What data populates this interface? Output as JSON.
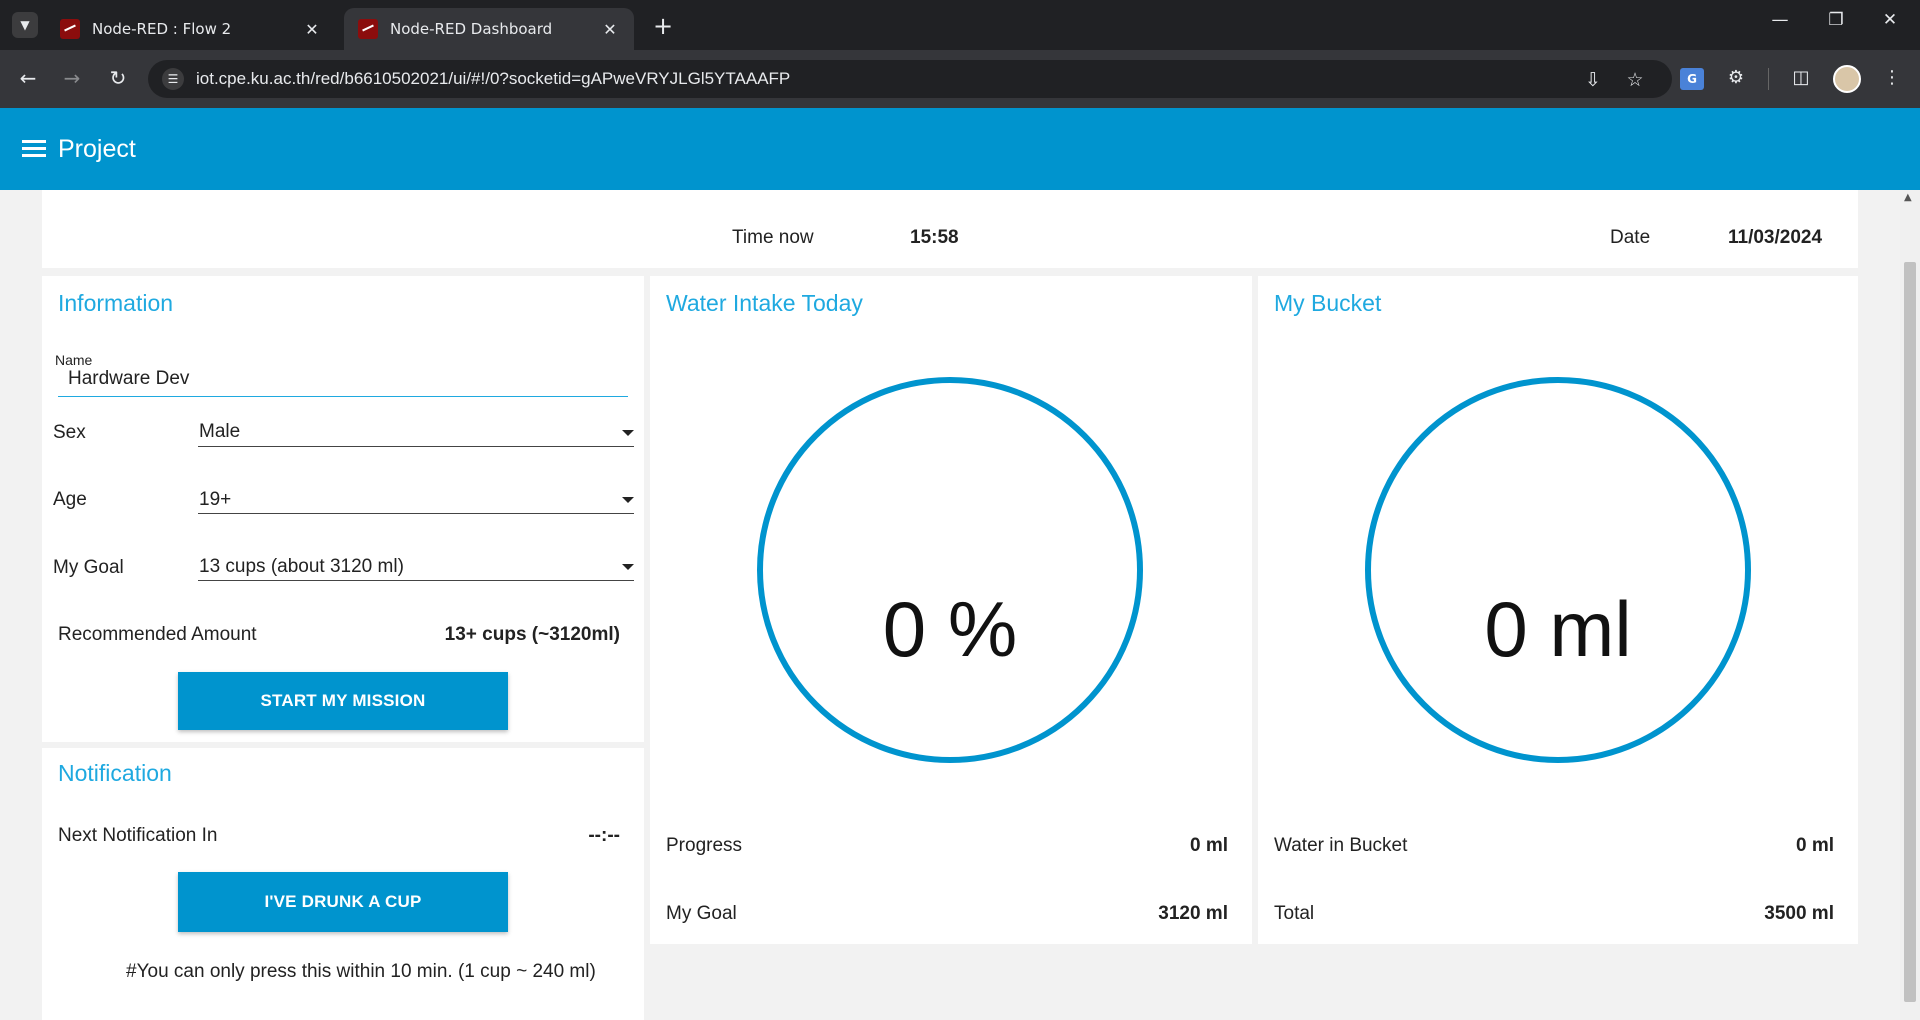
{
  "browser": {
    "tabs": [
      {
        "label": "Node-RED : Flow 2",
        "active": false
      },
      {
        "label": "Node-RED Dashboard",
        "active": true
      }
    ],
    "url": "iot.cpe.ku.ac.th/red/b6610502021/ui/#!/0?socketid=gAPweVRYJLGl5YTAAAFP"
  },
  "header": {
    "title": "Project"
  },
  "timebar": {
    "time_label": "Time now",
    "time_value": "15:58",
    "date_label": "Date",
    "date_value": "11/03/2024"
  },
  "information": {
    "title": "Information",
    "name_label": "Name",
    "name_value": "Hardware Dev",
    "sex_label": "Sex",
    "sex_value": "Male",
    "age_label": "Age",
    "age_value": "19+",
    "goal_label": "My Goal",
    "goal_value": "13 cups (about 3120 ml)",
    "recommended_label": "Recommended Amount",
    "recommended_value": "13+ cups (~3120ml)",
    "start_button": "START MY MISSION"
  },
  "notification": {
    "title": "Notification",
    "next_label": "Next Notification In",
    "next_value": "--:--",
    "drunk_button": "I'VE DRUNK A CUP",
    "note": "#You can only press this within 10 min. (1 cup ~ 240 ml)"
  },
  "water_intake": {
    "title": "Water Intake Today",
    "gauge_value": "0 %",
    "progress_percent": 0,
    "progress_label": "Progress",
    "progress_value": "0 ml",
    "goal_label": "My Goal",
    "goal_value": "3120 ml"
  },
  "bucket": {
    "title": "My Bucket",
    "gauge_value": "0 ml",
    "level_percent": 0,
    "water_label": "Water in Bucket",
    "water_value": "0 ml",
    "total_label": "Total",
    "total_value": "3500 ml"
  },
  "colors": {
    "accent": "#0094ce",
    "title": "#1fa9e0"
  }
}
